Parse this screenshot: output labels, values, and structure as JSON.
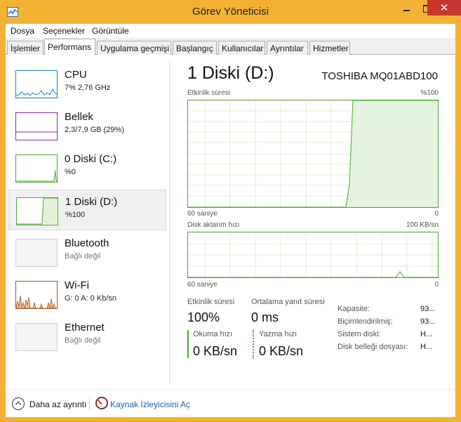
{
  "window": {
    "title": "Görev Yöneticisi",
    "close_glyph": "✕"
  },
  "menu": [
    "Dosya",
    "Seçenekler",
    "Görüntüle"
  ],
  "tabs": [
    "İşlemler",
    "Performans",
    "Uygulama geçmişi",
    "Başlangıç",
    "Kullanıcılar",
    "Ayrıntılar",
    "Hizmetler"
  ],
  "active_tab": "Performans",
  "sidebar": {
    "items": [
      {
        "name": "CPU",
        "sub": "7%  2,76 GHz",
        "color": "#1b7fc4"
      },
      {
        "name": "Bellek",
        "sub": "2,3/7,9 GB (29%)",
        "color": "#8b2aa6"
      },
      {
        "name": "0 Diski (C:)",
        "sub": "%0",
        "color": "#4ca62d"
      },
      {
        "name": "1 Diski (D:)",
        "sub": "%100",
        "color": "#4ca62d"
      },
      {
        "name": "Bluetooth",
        "sub": "Bağlı değil",
        "color": "#999999"
      },
      {
        "name": "Wi-Fi",
        "sub": "G: 0  A: 0 Kb/sn",
        "color": "#a7561b"
      },
      {
        "name": "Ethernet",
        "sub": "Bağlı değil",
        "color": "#999999"
      }
    ],
    "active": "1 Diski (D:)"
  },
  "detail": {
    "title": "1 Diski (D:)",
    "model": "TOSHIBA MQ01ABD100",
    "graph1": {
      "label": "Etkinlik süresi",
      "max": "%100",
      "time": "60 saniye",
      "min": "0"
    },
    "graph2": {
      "label": "Disk aktarım hızı",
      "max": "100 KB/sn",
      "time": "60 saniye",
      "min": "0"
    },
    "stats": {
      "active_time_label": "Etkinlik süresi",
      "active_time_value": "100%",
      "avg_response_label": "Ortalama yanıt süresi",
      "avg_response_value": "0 ms",
      "read_label": "Okuma hızı",
      "read_value": "0 KB/sn",
      "write_label": "Yazma hızı",
      "write_value": "0 KB/sn"
    },
    "properties": [
      {
        "key": "Kapasite:",
        "value": "93..."
      },
      {
        "key": "Biçimlendirilmiş:",
        "value": "93..."
      },
      {
        "key": "Sistem diski:",
        "value": "H..."
      },
      {
        "key": "Disk belleği dosyası:",
        "value": "H..."
      }
    ]
  },
  "footer": {
    "fewer_details": "Daha az ayrıntı",
    "resource_monitor": "Kaynak İzleyicisini Aç"
  }
}
